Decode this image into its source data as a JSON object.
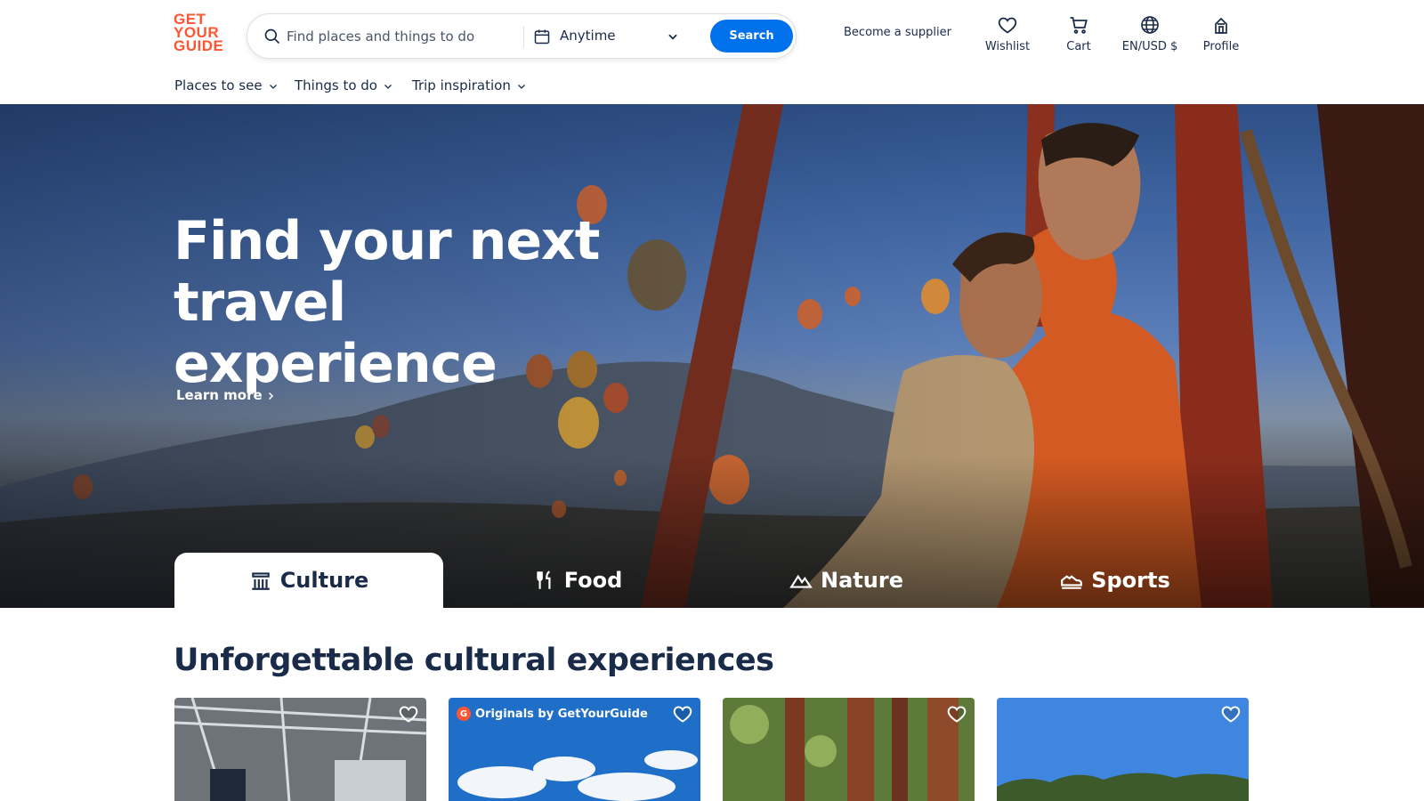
{
  "logo": {
    "lines": [
      "GET",
      "YOUR",
      "GUIDE"
    ],
    "color": "#ff5533"
  },
  "search": {
    "placeholder": "Find places and things to do",
    "date_label": "Anytime",
    "button_label": "Search"
  },
  "header": {
    "supplier_link": "Become a supplier",
    "wishlist": "Wishlist",
    "cart": "Cart",
    "language_currency": "EN/USD $",
    "profile": "Profile"
  },
  "subnav": [
    {
      "label": "Places to see"
    },
    {
      "label": "Things to do"
    },
    {
      "label": "Trip inspiration"
    }
  ],
  "hero": {
    "title_line1": "Find your next travel",
    "title_line2": "experience",
    "learn_more": "Learn more"
  },
  "categories": [
    {
      "label": "Culture",
      "icon": "museum-icon",
      "active": true
    },
    {
      "label": "Food",
      "icon": "fork-knife-icon",
      "active": false
    },
    {
      "label": "Nature",
      "icon": "mountain-icon",
      "active": false
    },
    {
      "label": "Sports",
      "icon": "sneaker-icon",
      "active": false
    }
  ],
  "section": {
    "title": "Unforgettable cultural experiences"
  },
  "cards": [
    {
      "badge": ""
    },
    {
      "badge": "Originals by GetYourGuide"
    },
    {
      "badge": ""
    },
    {
      "badge": ""
    }
  ],
  "colors": {
    "accent": "#0071eb",
    "brand": "#ff5533",
    "text": "#1a2b49"
  }
}
